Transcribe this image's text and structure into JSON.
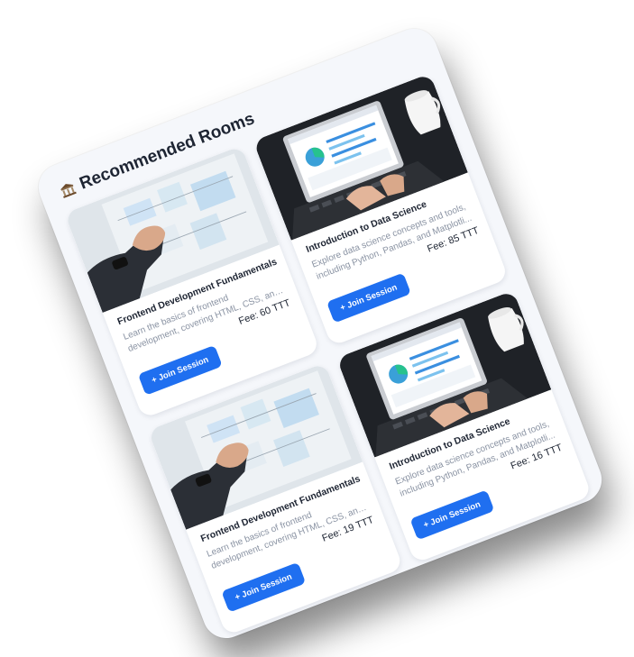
{
  "panel": {
    "title": "Recommended Rooms",
    "title_icon": "classical-building-icon"
  },
  "cards": [
    {
      "title": "Frontend Development Fundamentals",
      "description": "Learn the basics of frontend development, covering HTML, CSS, and JavaScript, wi...",
      "fee": "Fee: 60 TTT",
      "button_label": "+ Join Session",
      "image": "whiteboard-planning-photo"
    },
    {
      "title": "Introduction to Data Science",
      "description": "Explore data science concepts and tools, including Python, Pandas, and Matplotli...",
      "fee": "Fee: 85 TTT",
      "button_label": "+ Join Session",
      "image": "laptop-dashboard-photo"
    },
    {
      "title": "Frontend Development Fundamentals",
      "description": "Learn the basics of frontend development, covering HTML, CSS, and JavaScript, wi...",
      "fee": "Fee: 19 TTT",
      "button_label": "+ Join Session",
      "image": "whiteboard-planning-photo"
    },
    {
      "title": "Introduction to Data Science",
      "description": "Explore data science concepts and tools, including Python, Pandas, and Matplotli...",
      "fee": "Fee: 16 TTT",
      "button_label": "+ Join Session",
      "image": "laptop-dashboard-photo"
    }
  ],
  "colors": {
    "accent": "#1f6ff0",
    "panel_bg": "#f5f7fb",
    "text_dark": "#1e2533",
    "text_muted": "#8a93a3"
  }
}
